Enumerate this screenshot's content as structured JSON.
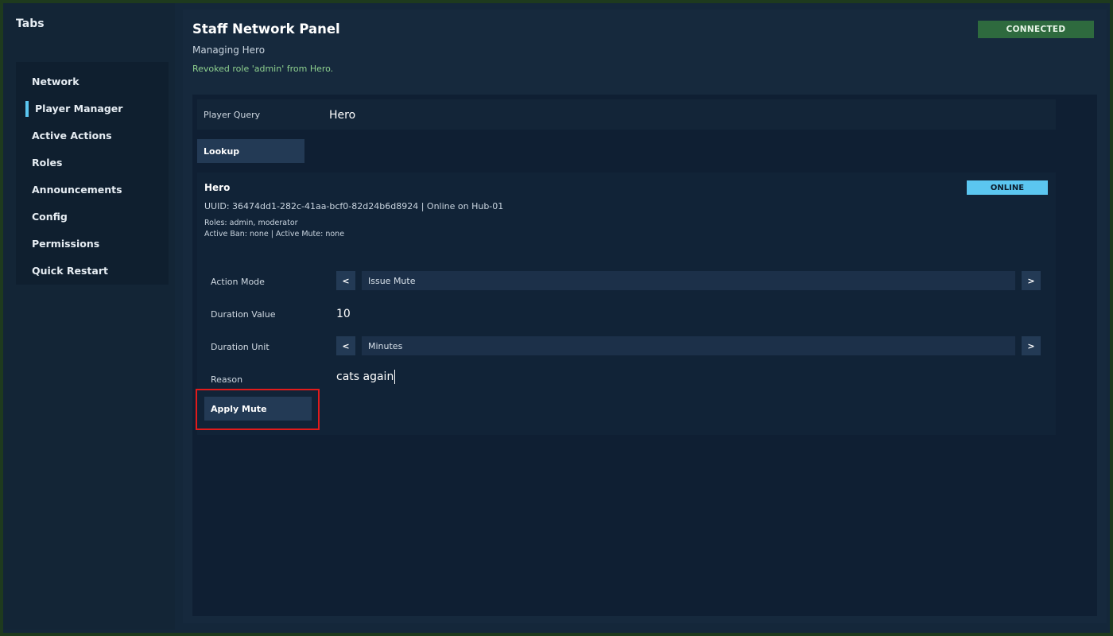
{
  "sidebar": {
    "title": "Tabs",
    "items": [
      {
        "label": "Network"
      },
      {
        "label": "Player Manager",
        "active": true
      },
      {
        "label": "Active Actions"
      },
      {
        "label": "Roles"
      },
      {
        "label": "Announcements"
      },
      {
        "label": "Config"
      },
      {
        "label": "Permissions"
      },
      {
        "label": "Quick Restart"
      }
    ]
  },
  "header": {
    "title": "Staff Network Panel",
    "subtitle": "Managing Hero",
    "status_message": "Revoked role 'admin' from Hero.",
    "connection_badge": "CONNECTED",
    "connection_color": "#2e6a3e"
  },
  "query": {
    "label": "Player Query",
    "value": "Hero",
    "lookup_label": "Lookup"
  },
  "player": {
    "name": "Hero",
    "uuid_line": "UUID: 36474dd1-282c-41aa-bcf0-82d24b6d8924 | Online on Hub-01",
    "roles_line": "Roles: admin, moderator",
    "bans_line": "Active Ban: none | Active Mute: none",
    "status_badge": "ONLINE",
    "status_color": "#5bc6f0"
  },
  "form": {
    "action_mode_label": "Action Mode",
    "action_mode_value": "Issue Mute",
    "duration_value_label": "Duration Value",
    "duration_value": "10",
    "duration_unit_label": "Duration Unit",
    "duration_unit_value": "Minutes",
    "reason_label": "Reason",
    "reason_value": "cats again",
    "prev_glyph": "<",
    "next_glyph": ">",
    "apply_label": "Apply Mute",
    "highlight_color": "#e21b1b"
  }
}
